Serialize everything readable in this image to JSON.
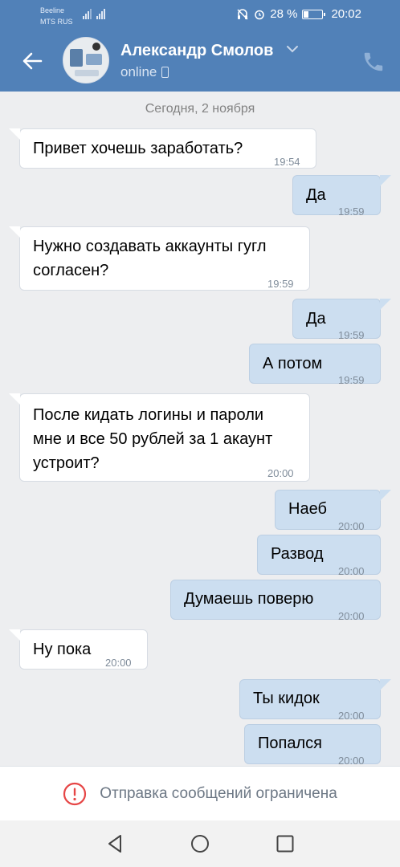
{
  "status_bar": {
    "carrier1": "Beeline",
    "carrier2": "MTS RUS",
    "battery": "28 %",
    "time": "20:02"
  },
  "header": {
    "contact_name": "Александр Смолов",
    "status": "online",
    "icons": [
      "back-arrow-icon",
      "chevron-down-icon",
      "phone-icon",
      "mobile-device-icon"
    ]
  },
  "chat": {
    "date": "Сегодня, 2 ноября",
    "messages": [
      {
        "dir": "in",
        "text": "Привет хочешь заработать?",
        "time": "19:54"
      },
      {
        "dir": "out",
        "text": "Да",
        "time": "19:59"
      },
      {
        "dir": "in",
        "text": "Нужно создавать аккаунты гугл\nсогласен?",
        "time": "19:59"
      },
      {
        "dir": "out",
        "text": "Да",
        "time": "19:59"
      },
      {
        "dir": "out",
        "text": "А потом",
        "time": "19:59"
      },
      {
        "dir": "in",
        "text": "После кидать логины и пароли\nмне и все 50 рублей за 1 акаунт\nустроит?",
        "time": "20:00"
      },
      {
        "dir": "out",
        "text": "Наеб",
        "time": "20:00"
      },
      {
        "dir": "out",
        "text": "Развод",
        "time": "20:00"
      },
      {
        "dir": "out",
        "text": "Думаешь поверю",
        "time": "20:00"
      },
      {
        "dir": "in",
        "text": "Ну пока",
        "time": "20:00"
      },
      {
        "dir": "out",
        "text": "Ты кидок",
        "time": "20:00"
      },
      {
        "dir": "out",
        "text": "Попался",
        "time": "20:00"
      }
    ]
  },
  "restriction": {
    "text": "Отправка сообщений ограничена",
    "icon": "warning-circle-icon"
  },
  "navbar": {
    "icons": [
      "nav-back-icon",
      "nav-home-icon",
      "nav-recents-icon"
    ]
  },
  "colors": {
    "header_bg": "#5181b8",
    "chat_bg": "#edeef0",
    "incoming_bubble": "#ffffff",
    "outgoing_bubble": "#ccdef0",
    "warning": "#e64646"
  }
}
